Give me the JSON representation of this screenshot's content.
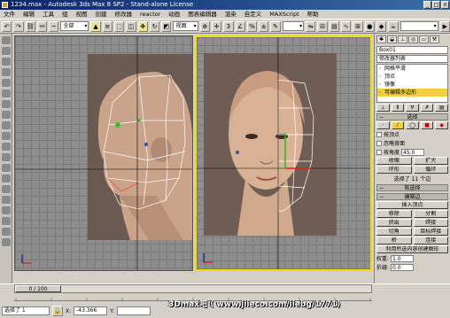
{
  "window": {
    "title": "1234.max - Autodesk 3ds Max 8 SP2 - Stand-alone License"
  },
  "menu": [
    "文件",
    "编辑",
    "工具",
    "组",
    "视图",
    "创建",
    "修改器",
    "reactor",
    "动画",
    "图表编辑器",
    "渲染",
    "自定义",
    "MAXScript",
    "帮助"
  ],
  "toolbar": {
    "selection_filter": "全部",
    "coord_system": "视图"
  },
  "right_panel": {
    "object_name": "Box01",
    "modifier_list": "修改器列表",
    "stack": [
      "网格平滑",
      "顶点",
      "镜像",
      "可编辑多边形"
    ],
    "selection_title": "选择",
    "by_vertex": "按顶点",
    "ignore_backfacing": "忽略背面",
    "angle_label": "按角度",
    "angle_value": "45.0",
    "shrink": "收缩",
    "grow": "扩大",
    "ring": "环形",
    "loop": "循环",
    "selected_info": "选择了 11 个边",
    "soft_selection": "软选择",
    "edit_edges": "编辑边",
    "insert_vertex": "插入顶点",
    "remove": "移除",
    "split": "分割",
    "extrude": "挤出",
    "weld": "焊接",
    "chamfer": "切角",
    "target_weld": "目标焊接",
    "bridge": "桥",
    "connect": "连接",
    "create_shape": "利用所选内容创建图形",
    "weight_label": "权重:",
    "weight_value": "1.0",
    "crease_label": "折缝:",
    "crease_value": "0.0"
  },
  "timeline": {
    "frame": "0 / 100",
    "ticks": [
      "0",
      "10",
      "20",
      "30",
      "40",
      "50",
      "60",
      "70",
      "80",
      "90",
      "100"
    ]
  },
  "status": {
    "selected": "选择了 1",
    "x_label": "X:",
    "x_value": "-43.366",
    "y_label": "Y:"
  },
  "watermark": "3Dmax吧 ( www.jiieco.com/iiebg/1771)"
}
